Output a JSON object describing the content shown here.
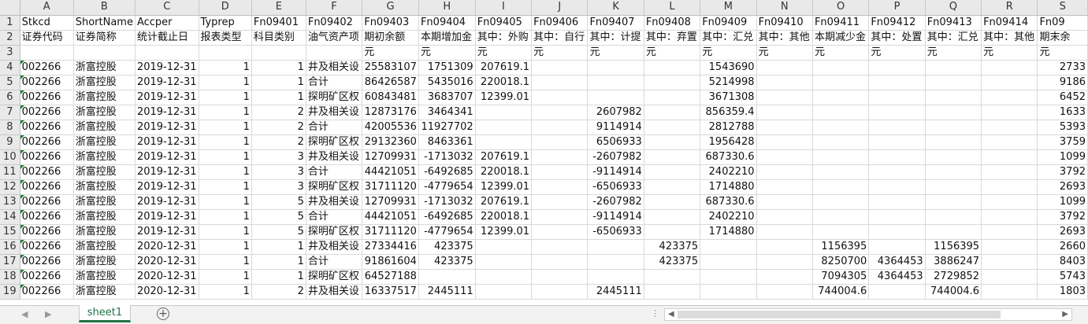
{
  "columns": [
    "A",
    "B",
    "C",
    "D",
    "E",
    "F",
    "G",
    "H",
    "I",
    "J",
    "K",
    "L",
    "M",
    "N",
    "O",
    "P",
    "Q",
    "R",
    "S"
  ],
  "num_columns": [
    "D",
    "E",
    "G",
    "H",
    "I",
    "J",
    "K",
    "L",
    "M",
    "N",
    "O",
    "P",
    "Q",
    "R",
    "S"
  ],
  "row_numbers": [
    "1",
    "2",
    "3",
    "4",
    "5",
    "6",
    "7",
    "8",
    "9",
    "10",
    "11",
    "12",
    "13",
    "14",
    "15",
    "16",
    "17",
    "18",
    "19"
  ],
  "rows": [
    [
      "Stkcd",
      "ShortName",
      "Accper",
      "Typrep",
      "Fn09401",
      "Fn09402",
      "Fn09403",
      "Fn09404",
      "Fn09405",
      "Fn09406",
      "Fn09407",
      "Fn09408",
      "Fn09409",
      "Fn09410",
      "Fn09411",
      "Fn09412",
      "Fn09413",
      "Fn09414",
      "Fn09"
    ],
    [
      "证券代码",
      "证券简称",
      "统计截止日",
      "报表类型",
      "科目类别",
      "油气资产项",
      "期初余额",
      "本期增加金",
      "其中：外购",
      "其中：自行",
      "其中：计提",
      "其中：弃置",
      "其中：汇兑",
      "其中：其他",
      "本期减少金",
      "其中：处置",
      "其中：汇兑",
      "其中：其他",
      "期末余"
    ],
    [
      "",
      "",
      "",
      "",
      "",
      "",
      "元",
      "元",
      "元",
      "元",
      "元",
      "元",
      "元",
      "元",
      "元",
      "元",
      "元",
      "元",
      "元"
    ],
    [
      "002266",
      "浙富控股",
      "2019-12-31",
      "1",
      "1",
      "井及相关设",
      "25583107",
      "1751309",
      "207619.1",
      "",
      "",
      "",
      "1543690",
      "",
      "",
      "",
      "",
      "",
      "2733"
    ],
    [
      "002266",
      "浙富控股",
      "2019-12-31",
      "1",
      "1",
      "合计",
      "86426587",
      "5435016",
      "220018.1",
      "",
      "",
      "",
      "5214998",
      "",
      "",
      "",
      "",
      "",
      "9186"
    ],
    [
      "002266",
      "浙富控股",
      "2019-12-31",
      "1",
      "1",
      "探明矿区权",
      "60843481",
      "3683707",
      "12399.01",
      "",
      "",
      "",
      "3671308",
      "",
      "",
      "",
      "",
      "",
      "6452"
    ],
    [
      "002266",
      "浙富控股",
      "2019-12-31",
      "1",
      "2",
      "井及相关设",
      "12873176",
      "3464341",
      "",
      "",
      "2607982",
      "",
      "856359.4",
      "",
      "",
      "",
      "",
      "",
      "1633"
    ],
    [
      "002266",
      "浙富控股",
      "2019-12-31",
      "1",
      "2",
      "合计",
      "42005536",
      "11927702",
      "",
      "",
      "9114914",
      "",
      "2812788",
      "",
      "",
      "",
      "",
      "",
      "5393"
    ],
    [
      "002266",
      "浙富控股",
      "2019-12-31",
      "1",
      "2",
      "探明矿区权",
      "29132360",
      "8463361",
      "",
      "",
      "6506933",
      "",
      "1956428",
      "",
      "",
      "",
      "",
      "",
      "3759"
    ],
    [
      "002266",
      "浙富控股",
      "2019-12-31",
      "1",
      "3",
      "井及相关设",
      "12709931",
      "-1713032",
      "207619.1",
      "",
      "-2607982",
      "",
      "687330.6",
      "",
      "",
      "",
      "",
      "",
      "1099"
    ],
    [
      "002266",
      "浙富控股",
      "2019-12-31",
      "1",
      "3",
      "合计",
      "44421051",
      "-6492685",
      "220018.1",
      "",
      "-9114914",
      "",
      "2402210",
      "",
      "",
      "",
      "",
      "",
      "3792"
    ],
    [
      "002266",
      "浙富控股",
      "2019-12-31",
      "1",
      "3",
      "探明矿区权",
      "31711120",
      "-4779654",
      "12399.01",
      "",
      "-6506933",
      "",
      "1714880",
      "",
      "",
      "",
      "",
      "",
      "2693"
    ],
    [
      "002266",
      "浙富控股",
      "2019-12-31",
      "1",
      "5",
      "井及相关设",
      "12709931",
      "-1713032",
      "207619.1",
      "",
      "-2607982",
      "",
      "687330.6",
      "",
      "",
      "",
      "",
      "",
      "1099"
    ],
    [
      "002266",
      "浙富控股",
      "2019-12-31",
      "1",
      "5",
      "合计",
      "44421051",
      "-6492685",
      "220018.1",
      "",
      "-9114914",
      "",
      "2402210",
      "",
      "",
      "",
      "",
      "",
      "3792"
    ],
    [
      "002266",
      "浙富控股",
      "2019-12-31",
      "1",
      "5",
      "探明矿区权",
      "31711120",
      "-4779654",
      "12399.01",
      "",
      "-6506933",
      "",
      "1714880",
      "",
      "",
      "",
      "",
      "",
      "2693"
    ],
    [
      "002266",
      "浙富控股",
      "2020-12-31",
      "1",
      "1",
      "井及相关设",
      "27334416",
      "423375",
      "",
      "",
      "",
      "423375",
      "",
      "",
      "1156395",
      "",
      "1156395",
      "",
      "2660"
    ],
    [
      "002266",
      "浙富控股",
      "2020-12-31",
      "1",
      "1",
      "合计",
      "91861604",
      "423375",
      "",
      "",
      "",
      "423375",
      "",
      "",
      "8250700",
      "4364453",
      "3886247",
      "",
      "8403"
    ],
    [
      "002266",
      "浙富控股",
      "2020-12-31",
      "1",
      "1",
      "探明矿区权",
      "64527188",
      "",
      "",
      "",
      "",
      "",
      "",
      "",
      "7094305",
      "4364453",
      "2729852",
      "",
      "5743"
    ],
    [
      "002266",
      "浙富控股",
      "2020-12-31",
      "1",
      "2",
      "井及相关设",
      "16337517",
      "2445111",
      "",
      "",
      "2445111",
      "",
      "",
      "",
      "744004.6",
      "",
      "744004.6",
      "",
      "1803"
    ]
  ],
  "sheet_tab": "sheet1",
  "add_sheet": "+",
  "nav_prev": "◀",
  "nav_next": "▶",
  "scroll_left": "◀",
  "scroll_right": "▶",
  "colors": {
    "tab_accent": "#217346",
    "header_bg": "#e9e9e9",
    "gridline": "#d9d9d9"
  }
}
